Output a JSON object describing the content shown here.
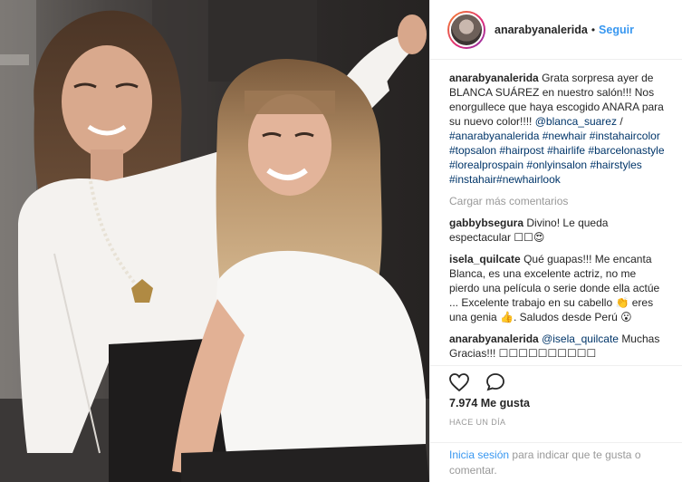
{
  "post": {
    "username": "anarabyanalerida",
    "follow_label": "Seguir",
    "separator": "•",
    "caption": {
      "author": "anarabyanalerida",
      "text": "Grata sorpresa ayer de BLANCA SUÁREZ en nuestro salón!!! Nos enorgullece que haya escogido ANARA para su nuevo color!!!!",
      "mention": "@blanca_suarez",
      "slash": "/",
      "hashtags": "#anarabyanalerida #newhair #instahaircolor #topsalon #hairpost #hairlife #barcelonastyle #lorealprospain #onlyinsalon #hairstyles #instahair#newhairlook"
    },
    "load_more": "Cargar más comentarios",
    "comments": [
      {
        "author": "gabbybsegura",
        "text": "Divino! Le queda espectacular ☐☐😍"
      },
      {
        "author": "isela_quilcate",
        "text": "Qué guapas!!! Me encanta Blanca, es una excelente actriz, no me pierdo una película o serie donde ella actúe ... Excelente trabajo en su cabello 👏 eres una genia 👍. Saludos desde Perú 😮"
      },
      {
        "author": "anarabyanalerida",
        "mention": "@isela_quilcate",
        "text": "Muchas Gracias!!! ☐☐☐☐☐☐☐☐☐☐"
      }
    ],
    "likes": "7.974 Me gusta",
    "time_ago": "HACE UN DÍA",
    "login": {
      "link": "Inicia sesión",
      "text": "para indicar que te gusta o comentar."
    },
    "icons": {
      "like": "heart-icon",
      "comment": "speech-bubble-icon"
    },
    "colors": {
      "link_blue": "#3897f0",
      "hashtag_blue": "#003569",
      "muted": "#999999",
      "text": "#262626"
    }
  }
}
